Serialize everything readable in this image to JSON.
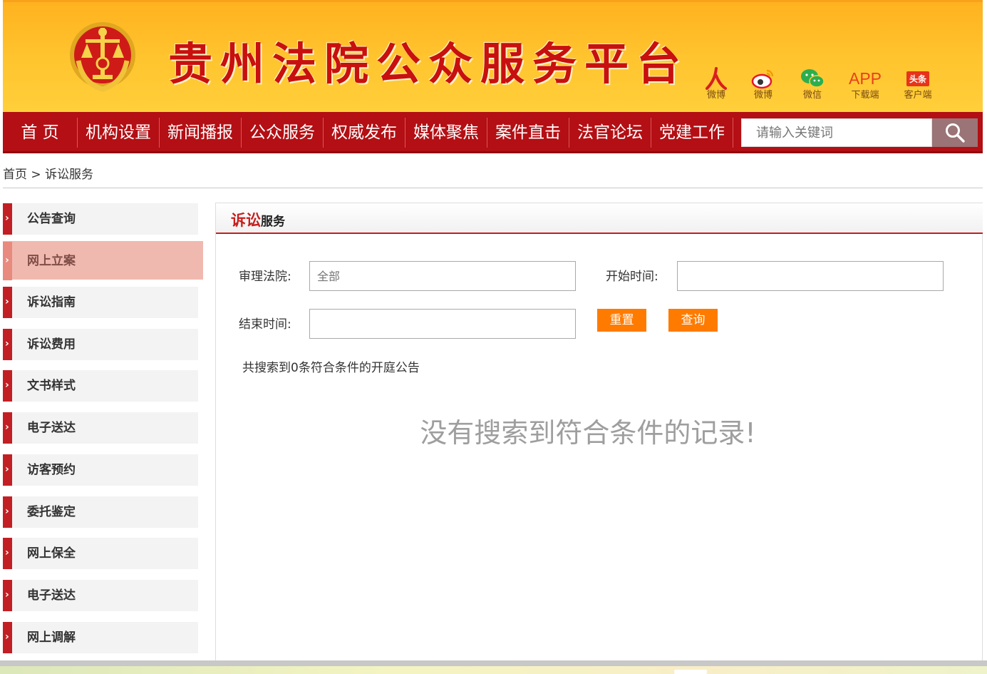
{
  "header": {
    "site_title": "贵州法院公众服务平台",
    "links": [
      {
        "label": "微博",
        "icon": "people-weibo-icon"
      },
      {
        "label": "微博",
        "icon": "sina-weibo-icon"
      },
      {
        "label": "微信",
        "icon": "wechat-icon"
      },
      {
        "label": "下载端",
        "icon": "app-icon",
        "icon_text": "APP"
      },
      {
        "label": "客户端",
        "icon": "toutiao-icon",
        "icon_text": "头条"
      }
    ]
  },
  "nav": {
    "items": [
      "首 页",
      "机构设置",
      "新闻播报",
      "公众服务",
      "权威发布",
      "媒体聚焦",
      "案件直击",
      "法官论坛",
      "党建工作"
    ],
    "search_placeholder": "请输入关键词"
  },
  "breadcrumb": {
    "home": "首页",
    "sep": ">",
    "current": "诉讼服务"
  },
  "sidebar": {
    "items": [
      "公告查询",
      "网上立案",
      "诉讼指南",
      "诉讼费用",
      "文书样式",
      "电子送达",
      "访客预约",
      "委托鉴定",
      "网上保全",
      "电子送达",
      "网上调解"
    ],
    "active_index": 1
  },
  "panel": {
    "title_red": "诉讼",
    "title_dark": "服务",
    "court_label": "审理法院:",
    "court_placeholder": "全部",
    "start_label": "开始时间:",
    "end_label": "结束时间:",
    "reset_label": "重置",
    "query_label": "查询",
    "count_text": "共搜索到0条符合条件的开庭公告",
    "empty_text": "没有搜索到符合条件的记录!"
  },
  "colors": {
    "accent_red": "#b30f14",
    "button_orange": "#ff7b00",
    "header_yellow": "#ffc42e"
  }
}
